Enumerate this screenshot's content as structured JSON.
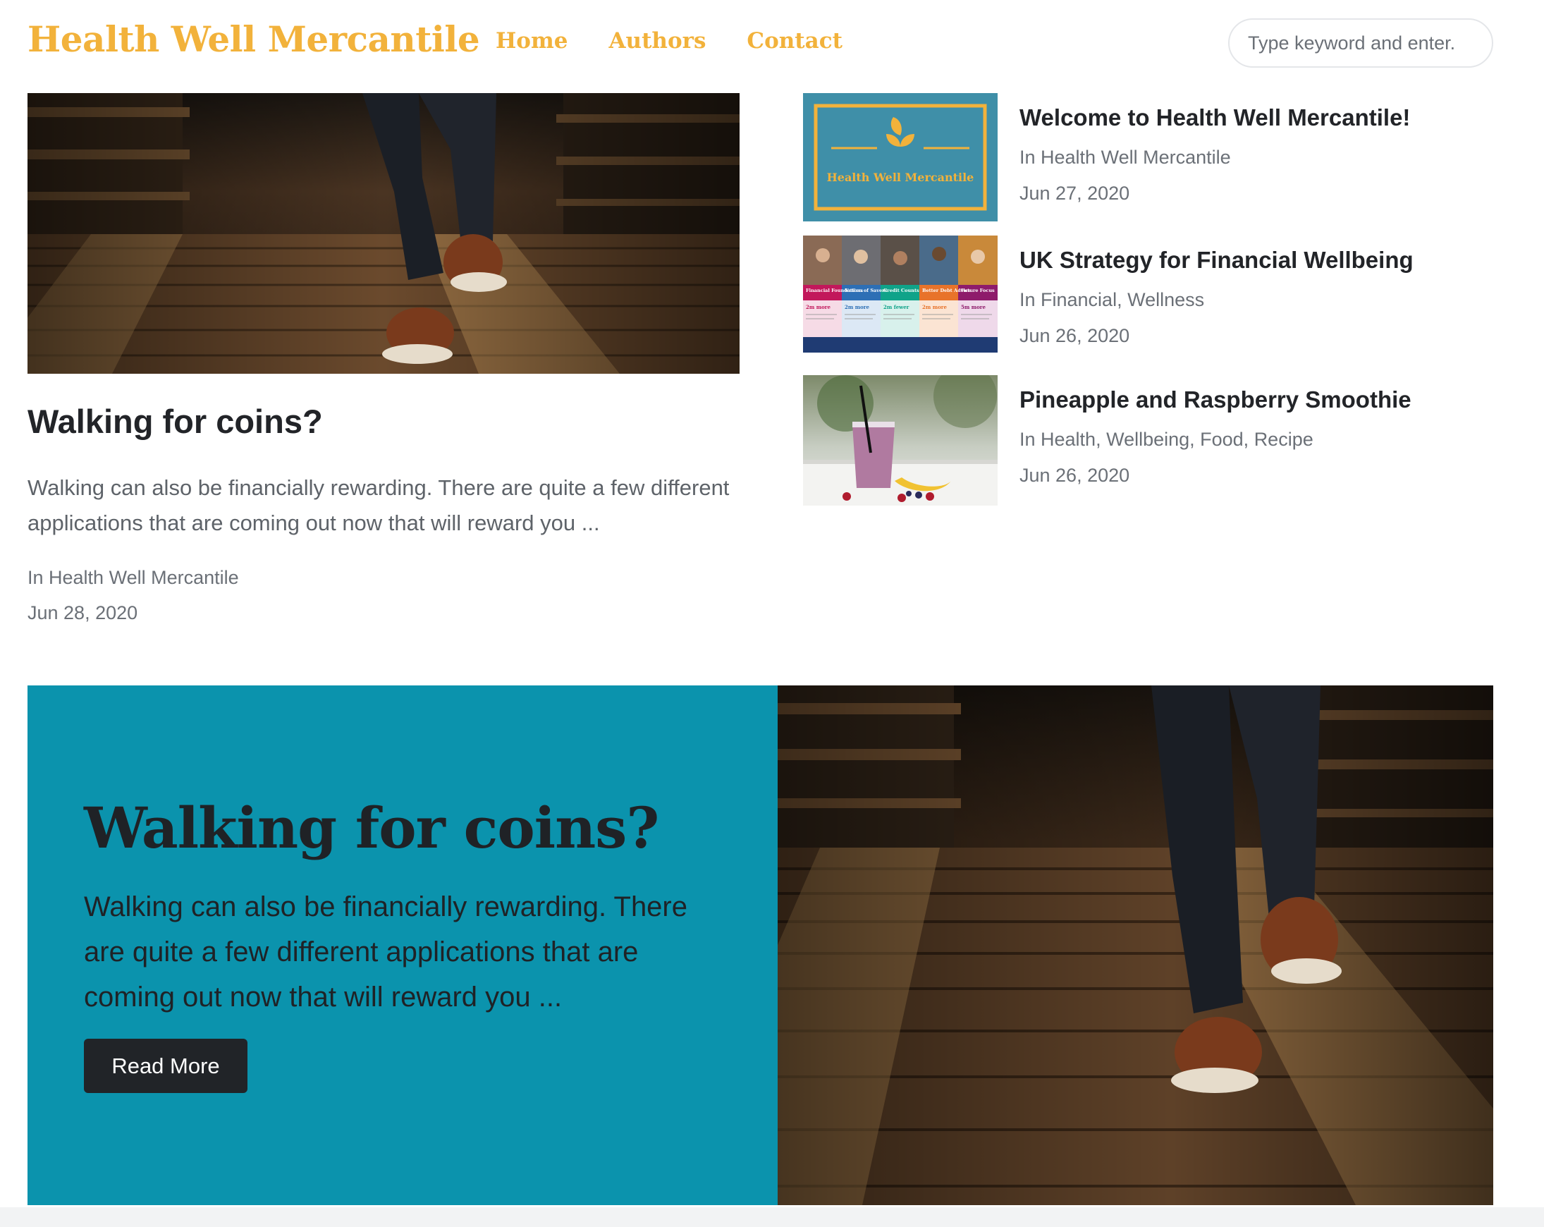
{
  "header": {
    "brand": "Health Well Mercantile",
    "nav": [
      {
        "label": "Home"
      },
      {
        "label": "Authors"
      },
      {
        "label": "Contact"
      }
    ],
    "search_placeholder": "Type keyword and enter."
  },
  "featured": {
    "title": "Walking for coins?",
    "excerpt": "Walking can also be financially rewarding. There are quite a few different applications that are coming out now that will reward you ...",
    "category": "In Health Well Mercantile",
    "date": "Jun 28, 2020"
  },
  "side_posts": [
    {
      "title": "Welcome to Health Well Mercantile!",
      "category": "In Health Well Mercantile",
      "date": "Jun 27, 2020",
      "thumb_text": "Health Well Mercantile"
    },
    {
      "title": "UK Strategy for Financial Wellbeing",
      "category": "In Financial, Wellness",
      "date": "Jun 26, 2020",
      "thumb_labels": [
        "Financial Foundations",
        "Nation of Savers",
        "Credit Counts",
        "Better Debt Advice",
        "Future Focus"
      ],
      "thumb_values": [
        "2m more",
        "2m more",
        "2m fewer",
        "2m more",
        "5m more"
      ]
    },
    {
      "title": "Pineapple and Raspberry Smoothie",
      "category": "In Health, Wellbeing, Food, Recipe",
      "date": "Jun 26, 2020"
    }
  ],
  "hero": {
    "title": "Walking for coins?",
    "excerpt": "Walking can also be financially rewarding. There are quite a few different applications that are coming out now that will reward you ...",
    "button": "Read More"
  },
  "colors": {
    "brand": "#f2b23b",
    "hero_bg": "#0b93ad",
    "button_bg": "#212428"
  }
}
